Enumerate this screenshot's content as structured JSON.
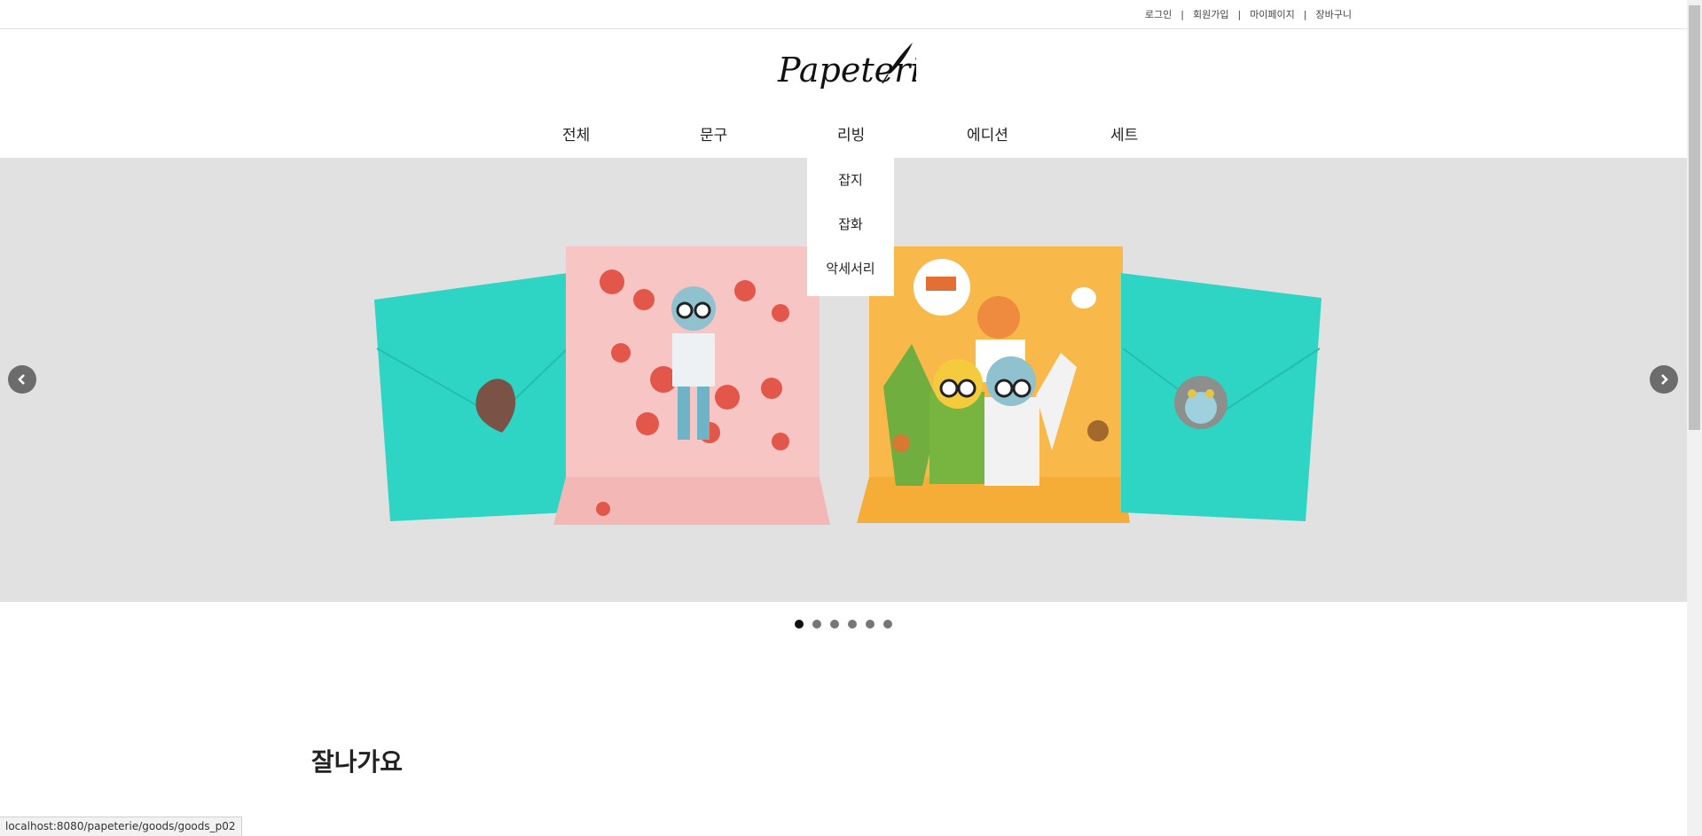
{
  "top_links": [
    "로그인",
    "회원가입",
    "마이페이지",
    "장바구니"
  ],
  "logo_text": "Papeterie",
  "nav": [
    "전체",
    "문구",
    "리빙",
    "에디션",
    "세트"
  ],
  "dropdown": [
    "잡지",
    "잡화",
    "악세서리"
  ],
  "slider": {
    "total": 6,
    "active": 1
  },
  "section_title": "잘나가요",
  "status_url": "localhost:8080/papeterie/goods/goods_p02",
  "colors": {
    "hero_bg": "#e1e1e1",
    "envelope": "#31d6c6",
    "pink_card": "#f7c3c3",
    "yellow_card": "#f9b84a"
  },
  "icons": {
    "prev": "chevron-left-icon",
    "next": "chevron-right-icon",
    "logo": "quill-feather-icon"
  }
}
